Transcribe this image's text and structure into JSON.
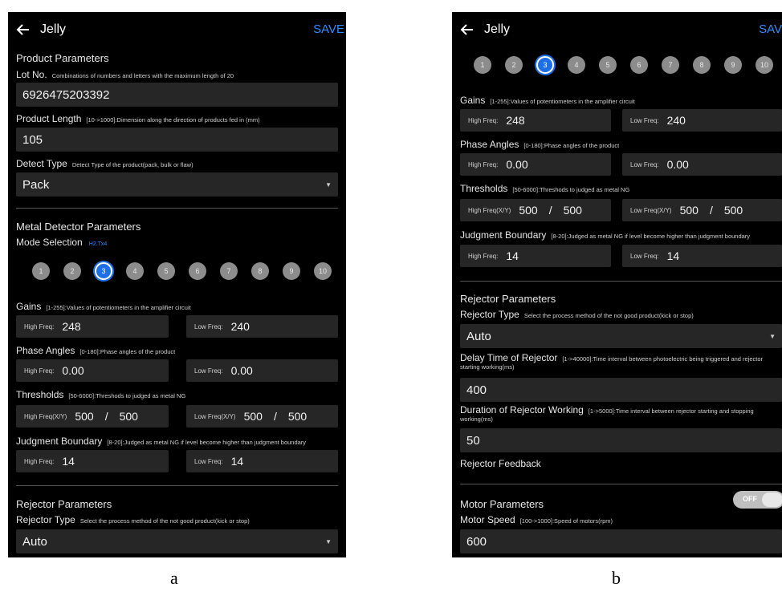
{
  "screen_a": {
    "title": "Jelly",
    "save": "SAVE",
    "product_params": "Product Parameters",
    "lot_label": "Lot No.",
    "lot_desc": "Combinations of numbers and letters with the maximum length of 20",
    "lot_value": "6926475203392",
    "length_label": "Product Length",
    "length_desc": "[10->1000]:Dimension along the direction of products fed in (mm)",
    "length_value": "105",
    "detect_label": "Detect Type",
    "detect_desc": "Detect Type of the product(pack, bulk or flaw)",
    "detect_value": "Pack",
    "metal_params": "Metal Detector Parameters",
    "mode_label": "Mode Selection",
    "mode_value": "H2.Tx4",
    "circles": [
      "1",
      "2",
      "3",
      "4",
      "5",
      "6",
      "7",
      "8",
      "9",
      "10"
    ],
    "selected_circle": "3",
    "gains_label": "Gains",
    "gains_desc": "[1-255]:Values of potentiometers in the amplifier circuit",
    "phase_label": "Phase Angles",
    "phase_desc": "[0-180]:Phase angles of the product",
    "thr_label": "Thresholds",
    "thr_desc": "[50-6000]:Threshods to judged as metal NG",
    "judg_label": "Judgment Boundary",
    "judg_desc": "[8-20]:Judged as metal NG if level become higher than judgment boundary",
    "rej_params": "Rejector Parameters",
    "rej_type_label": "Rejector Type",
    "rej_type_desc": "Select the process method of the not good product(kick or stop)",
    "rej_type_value": "Auto"
  },
  "screen_b": {
    "title": "Jelly",
    "save": "SAV",
    "circles": [
      "1",
      "2",
      "3",
      "4",
      "5",
      "6",
      "7",
      "8",
      "9",
      "10"
    ],
    "gains_label": "Gains",
    "gains_desc": "[1-255]:Values of potentiometers in the amplifier circuit",
    "phase_label": "Phase Angles",
    "phase_desc": "[0-180]:Phase angles of the product",
    "thr_label": "Thresholds",
    "thr_desc": "[50-6000]:Threshods to judged as metal NG",
    "judg_label": "Judgment Boundary",
    "judg_desc": "[8-20]:Judged as metal NG if level become higher than judgment boundary",
    "rej_params": "Rejector Parameters",
    "rej_type_label": "Rejector Type",
    "rej_type_desc": "Select the process method of the not good product(kick or stop)",
    "rej_type_value": "Auto",
    "delay_label": "Delay Time of Rejector",
    "delay_desc": "[1->40000]:Time interval between photoelectric being triggered and rejector starting working(ms)",
    "delay_value": "400",
    "duration_label": "Duration of Rejector Working",
    "duration_desc": "[1->5000]:Time interval between rejector starting and stopping working(ms)",
    "duration_value": "50",
    "feedback_label": "Rejector Feedback",
    "feedback_state": "OFF",
    "motor_params": "Motor Parameters",
    "motor_label": "Motor Speed",
    "motor_desc": "[100->1000]:Speed of motors(rpm)",
    "motor_value": "600"
  },
  "shared_values": {
    "high_freq": "High Freq:",
    "low_freq": "Low Freq:",
    "high_freq_xy": "High Freq(X/Y)",
    "low_freq_xy": "Low Freq(X/Y)",
    "gains_high": "248",
    "gains_low": "240",
    "phase_high": "0.00",
    "phase_low": "0.00",
    "thr_high_x": "500",
    "thr_high_y": "500",
    "thr_low_x": "500",
    "thr_low_y": "500",
    "slash": "/",
    "judg_high": "14",
    "judg_low": "14"
  },
  "captions": {
    "a": "a",
    "b": "b"
  },
  "colors": {
    "accent": "#2f8cff",
    "background": "#000000",
    "field": "#262626",
    "selected_circle": "#1c6fe6"
  }
}
